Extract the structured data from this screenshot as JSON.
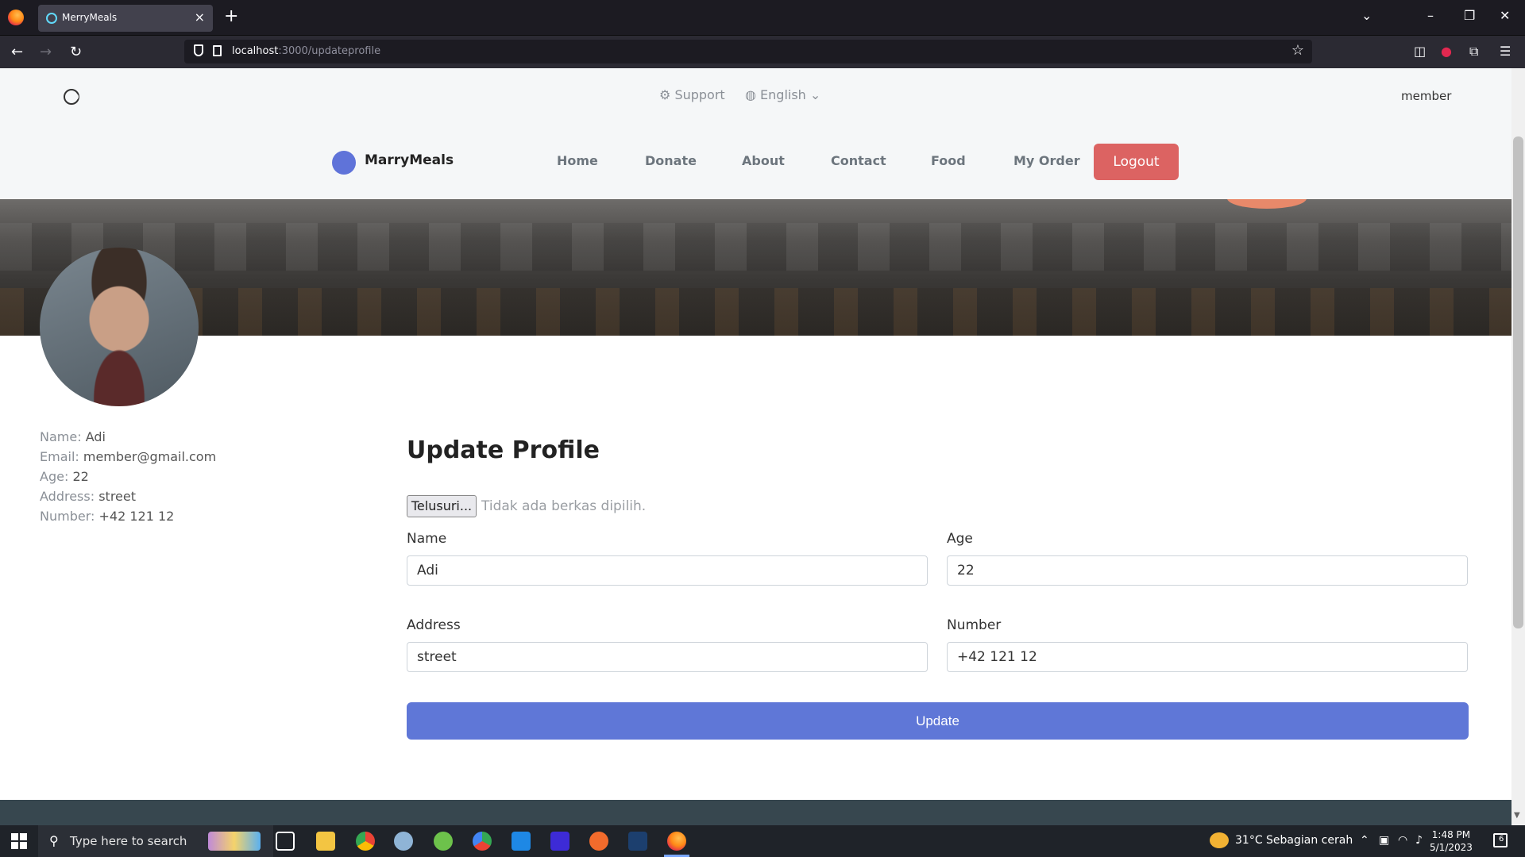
{
  "browser": {
    "tab_title": "MerryMeals",
    "url_host": "localhost",
    "url_path": ":3000/updateprofile"
  },
  "header": {
    "support": "Support",
    "language": "English",
    "user": "member"
  },
  "nav": {
    "brand": "MarryMeals",
    "links": [
      "Home",
      "Donate",
      "About",
      "Contact",
      "Food",
      "My Order"
    ],
    "logout": "Logout"
  },
  "profile": {
    "name_label": "Name:",
    "name": "Adi",
    "email_label": "Email:",
    "email": "member@gmail.com",
    "age_label": "Age:",
    "age": "22",
    "address_label": "Address:",
    "address": "street",
    "number_label": "Number:",
    "number": "+42 121 12"
  },
  "form": {
    "title": "Update Profile",
    "file_button": "Telusuri...",
    "file_status": "Tidak ada berkas dipilih.",
    "name_label": "Name",
    "name_value": "Adi",
    "age_label": "Age",
    "age_value": "22",
    "address_label": "Address",
    "address_value": "street",
    "number_label": "Number",
    "number_value": "+42 121 12",
    "submit": "Update"
  },
  "taskbar": {
    "search_placeholder": "Type here to search",
    "weather": "31°C  Sebagian cerah",
    "time": "1:48 PM",
    "date": "5/1/2023",
    "notification_count": "6"
  },
  "colors": {
    "accent": "#5f77d7",
    "logout": "#dc6362",
    "footer": "#37474f"
  }
}
